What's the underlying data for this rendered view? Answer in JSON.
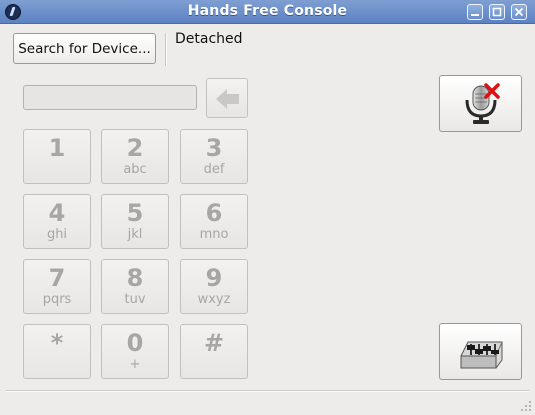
{
  "window": {
    "title": "Hands Free Console",
    "icon": "app-logo-icon",
    "controls": [
      "minimize-icon",
      "maximize-icon",
      "close-icon"
    ]
  },
  "toolbar": {
    "search_label": "Search for Device...",
    "status_text": "Detached"
  },
  "dialpad": {
    "entry_value": "",
    "backspace_icon": "backspace-arrow-icon",
    "keys": [
      {
        "digit": "1",
        "letters": ""
      },
      {
        "digit": "2",
        "letters": "abc"
      },
      {
        "digit": "3",
        "letters": "def"
      },
      {
        "digit": "4",
        "letters": "ghi"
      },
      {
        "digit": "5",
        "letters": "jkl"
      },
      {
        "digit": "6",
        "letters": "mno"
      },
      {
        "digit": "7",
        "letters": "pqrs"
      },
      {
        "digit": "8",
        "letters": "tuv"
      },
      {
        "digit": "9",
        "letters": "wxyz"
      },
      {
        "digit": "*",
        "letters": ""
      },
      {
        "digit": "0",
        "letters": "+"
      },
      {
        "digit": "#",
        "letters": ""
      }
    ]
  },
  "side_buttons": {
    "mute_icon": "microphone-muted-icon",
    "mixer_icon": "audio-mixer-icon"
  },
  "colors": {
    "titlebar": "#6a8dc9",
    "window_bg": "#edeceb",
    "disabled_text": "#a7a6a3",
    "mute_x": "#e01010"
  }
}
